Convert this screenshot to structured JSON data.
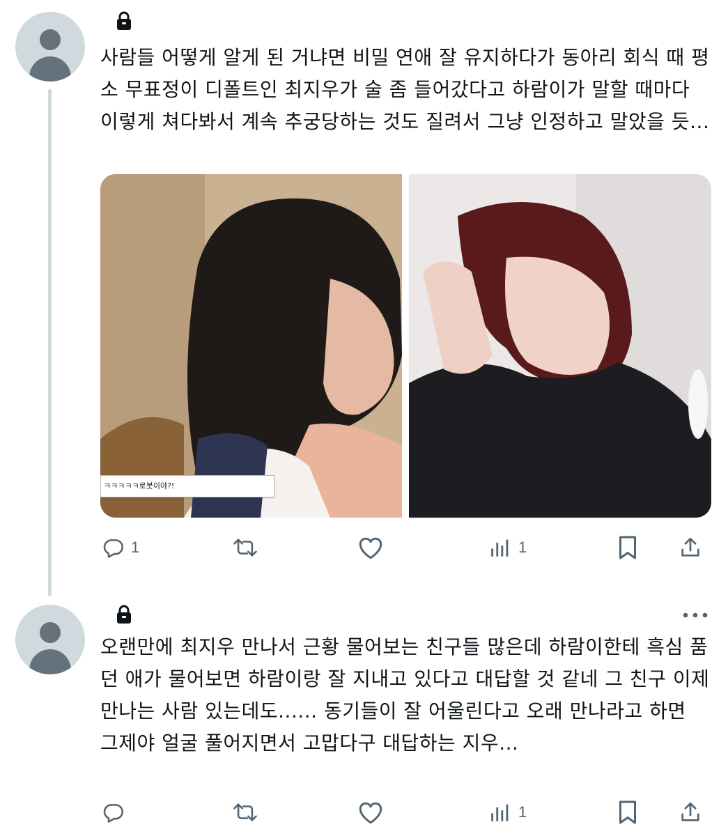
{
  "tweets": [
    {
      "text": "사람들 어떻게 알게 된 거냐면 비밀 연애 잘 유지하다가 동아리 회식 때 평소 무표정이 디폴트인 최지우가 술 좀 들어갔다고 하람이가 말할 때마다 이렇게 쳐다봐서 계속 추궁당하는 것도 질려서 그냥 인정하고 말았을 듯...",
      "media_caption": "ㅋㅋㅋㅋㅋ로봇이야?!",
      "reply_count": "1",
      "view_count": "1"
    },
    {
      "text": "오랜만에 최지우 만나서 근황 물어보는 친구들 많은데 하람이한테 흑심 품던 애가 물어보면 하람이랑 잘 지내고 있다고 대답할 것 같네 그 친구 이제 만나는 사람 있는데도...... 동기들이 잘 어울린다고 오래 만나라고 하면 그제야 얼굴 풀어지면서 고맙다구 대답하는 지우...",
      "view_count": "1"
    }
  ],
  "colors": {
    "icon_gray": "#536471",
    "avatar_bg": "#cfd9de",
    "text": "#0f1419"
  },
  "icons": [
    "lock-icon",
    "reply-icon",
    "retweet-icon",
    "like-icon",
    "views-icon",
    "bookmark-icon",
    "share-icon",
    "more-icon"
  ]
}
